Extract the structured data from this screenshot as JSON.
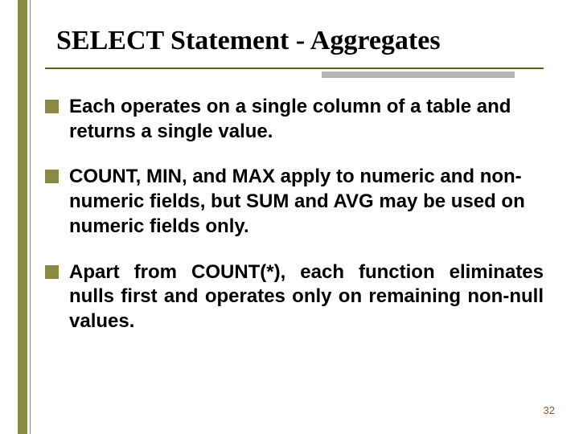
{
  "colors": {
    "accent_olive": "#8a8a44",
    "title_underline": "#6b5a13",
    "title_shadow": "#b6b6b6",
    "page_number": "#8a5a2a"
  },
  "slide": {
    "title": "SELECT Statement - Aggregates",
    "bullets": [
      "Each operates on a single column of a table and returns a single value.",
      "COUNT, MIN, and MAX apply to numeric and non-numeric fields, but SUM and AVG may be used on numeric fields only.",
      "Apart from COUNT(*), each function eliminates nulls first and operates only on remaining non-null values."
    ],
    "page_number": "32"
  }
}
